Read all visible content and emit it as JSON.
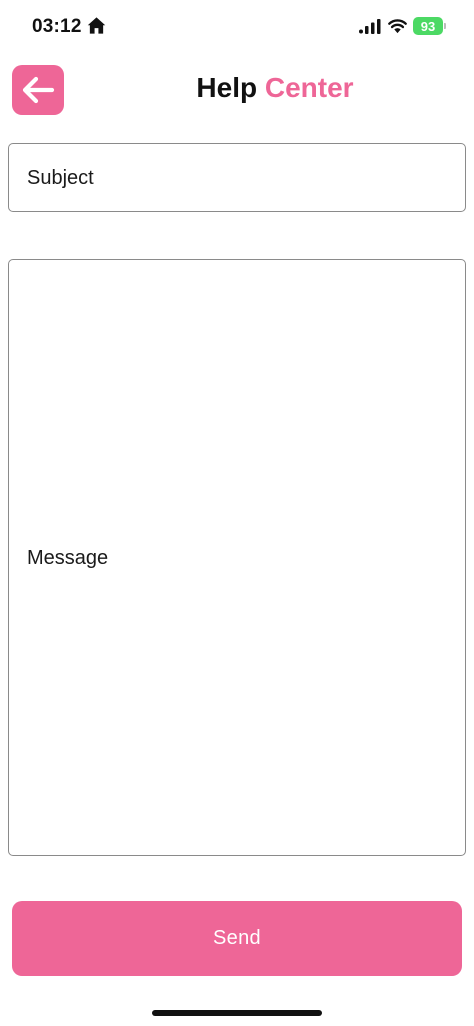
{
  "status_bar": {
    "time": "03:12",
    "battery": "93",
    "icons": [
      "home-icon",
      "signal-icon",
      "wifi-icon",
      "battery-icon"
    ]
  },
  "header": {
    "back_icon": "arrow-left-icon",
    "title_part1": "Help",
    "title_part2": "Center"
  },
  "form": {
    "subject_placeholder": "Subject",
    "message_placeholder": "Message",
    "send_label": "Send"
  },
  "colors": {
    "accent": "#ee6697",
    "battery": "#4cd964",
    "border": "#8a8a8a"
  }
}
